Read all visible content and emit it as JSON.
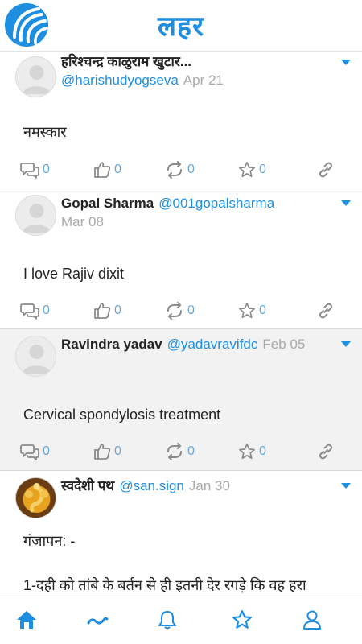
{
  "app": {
    "title": "लहर",
    "brand_color": "#1e8ee0"
  },
  "posts": [
    {
      "name": "हरिश्चन्द्र काळुराम खुटार...",
      "handle": "@harishudyogseva",
      "date": "Apr 21",
      "text": "नमस्कार",
      "comments": "0",
      "likes": "0",
      "reposts": "0",
      "stars": "0",
      "avatar": "default-avatar"
    },
    {
      "name": "Gopal Sharma",
      "handle": "@001gopalsharma",
      "date": "Mar 08",
      "text": "I love Rajiv dixit",
      "comments": "0",
      "likes": "0",
      "reposts": "0",
      "stars": "0",
      "avatar": "default-avatar"
    },
    {
      "name": "Ravindra yadav",
      "handle": "@yadavravifdc",
      "date": "Feb 05",
      "text": "Cervical spondylosis treatment",
      "comments": "0",
      "likes": "0",
      "reposts": "0",
      "stars": "0",
      "avatar": "default-avatar",
      "highlighted": true
    },
    {
      "name": "स्वदेशी पथ",
      "handle": "@san.sign",
      "date": "Jan 30",
      "text": "गंजापन: -",
      "text2": "1-दही को तांबे के बर्तन से ही इतनी देर रगड़े कि वह हरा",
      "avatar": "ganesha-avatar"
    }
  ],
  "nav": {
    "items": [
      "home-icon",
      "wave-icon",
      "bell-icon",
      "star-icon",
      "user-icon"
    ],
    "color": "#1e8ee0"
  }
}
